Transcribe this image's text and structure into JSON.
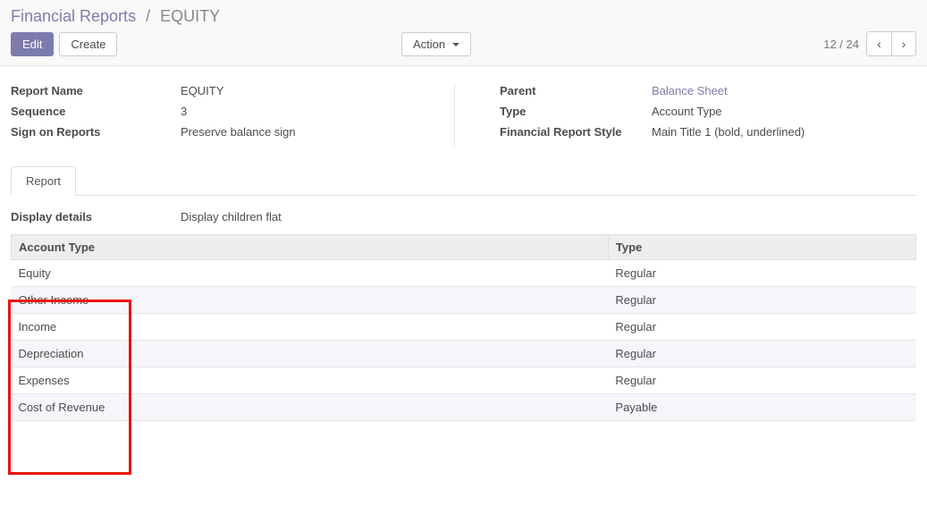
{
  "breadcrumb": {
    "parent": "Financial Reports",
    "sep": "/",
    "current": "EQUITY"
  },
  "buttons": {
    "edit": "Edit",
    "create": "Create",
    "action": "Action"
  },
  "pager": {
    "text": "12 / 24"
  },
  "left_fields": {
    "report_name_label": "Report Name",
    "report_name_value": "EQUITY",
    "sequence_label": "Sequence",
    "sequence_value": "3",
    "sign_label": "Sign on Reports",
    "sign_value": "Preserve balance sign"
  },
  "right_fields": {
    "parent_label": "Parent",
    "parent_value": "Balance Sheet",
    "type_label": "Type",
    "type_value": "Account Type",
    "style_label": "Financial Report Style",
    "style_value": "Main Title 1 (bold, underlined)"
  },
  "tab": {
    "report": "Report"
  },
  "display": {
    "label": "Display details",
    "value": "Display children flat"
  },
  "table": {
    "col_account_type": "Account Type",
    "col_type": "Type",
    "rows": [
      {
        "account_type": "Equity",
        "type": "Regular"
      },
      {
        "account_type": "Other Income",
        "type": "Regular"
      },
      {
        "account_type": "Income",
        "type": "Regular"
      },
      {
        "account_type": "Depreciation",
        "type": "Regular"
      },
      {
        "account_type": "Expenses",
        "type": "Regular"
      },
      {
        "account_type": "Cost of Revenue",
        "type": "Payable"
      }
    ]
  }
}
